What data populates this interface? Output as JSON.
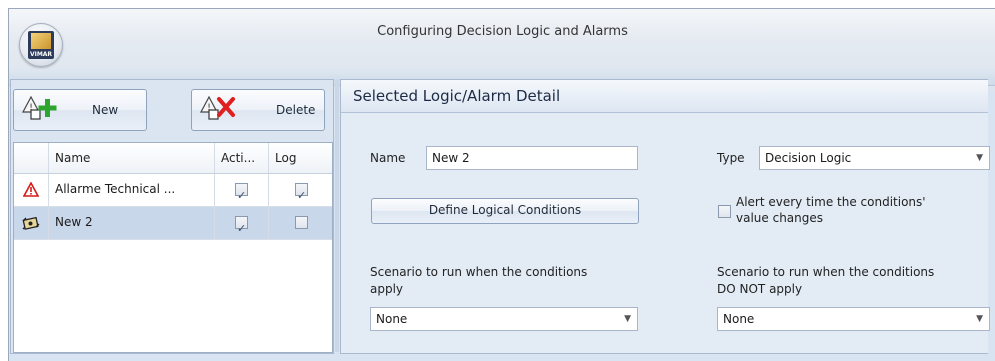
{
  "window": {
    "title": "Configuring Decision Logic and Alarms",
    "logo_text": "VIMAR"
  },
  "toolbar": {
    "new_label": "New",
    "delete_label": "Delete"
  },
  "grid": {
    "columns": [
      "Name",
      "Acti...",
      "Log"
    ],
    "rows": [
      {
        "icon": "alarm-warning-icon",
        "name": "Allarme Technical ...",
        "active": true,
        "log": true,
        "selected": false
      },
      {
        "icon": "decision-logic-icon",
        "name": "New 2",
        "active": true,
        "log": false,
        "selected": true
      }
    ]
  },
  "detail": {
    "title": "Selected Logic/Alarm Detail",
    "name_label": "Name",
    "name_value": "New 2",
    "type_label": "Type",
    "type_value": "Decision Logic",
    "define_button": "Define Logical Conditions",
    "alert_checkbox_line1": "Alert every time the conditions'",
    "alert_checkbox_line2": "value changes",
    "alert_checked": false,
    "scenario_apply_line1": "Scenario to run when the conditions",
    "scenario_apply_line2": "apply",
    "scenario_apply_value": "None",
    "scenario_notapply_line1": "Scenario to run when the conditions",
    "scenario_notapply_line2": "DO NOT apply",
    "scenario_notapply_value": "None"
  },
  "colors": {
    "selection": "#c9d7ea",
    "add_green": "#2ea52e",
    "delete_red": "#e02020",
    "panel_bg": "#e3ebf5"
  }
}
